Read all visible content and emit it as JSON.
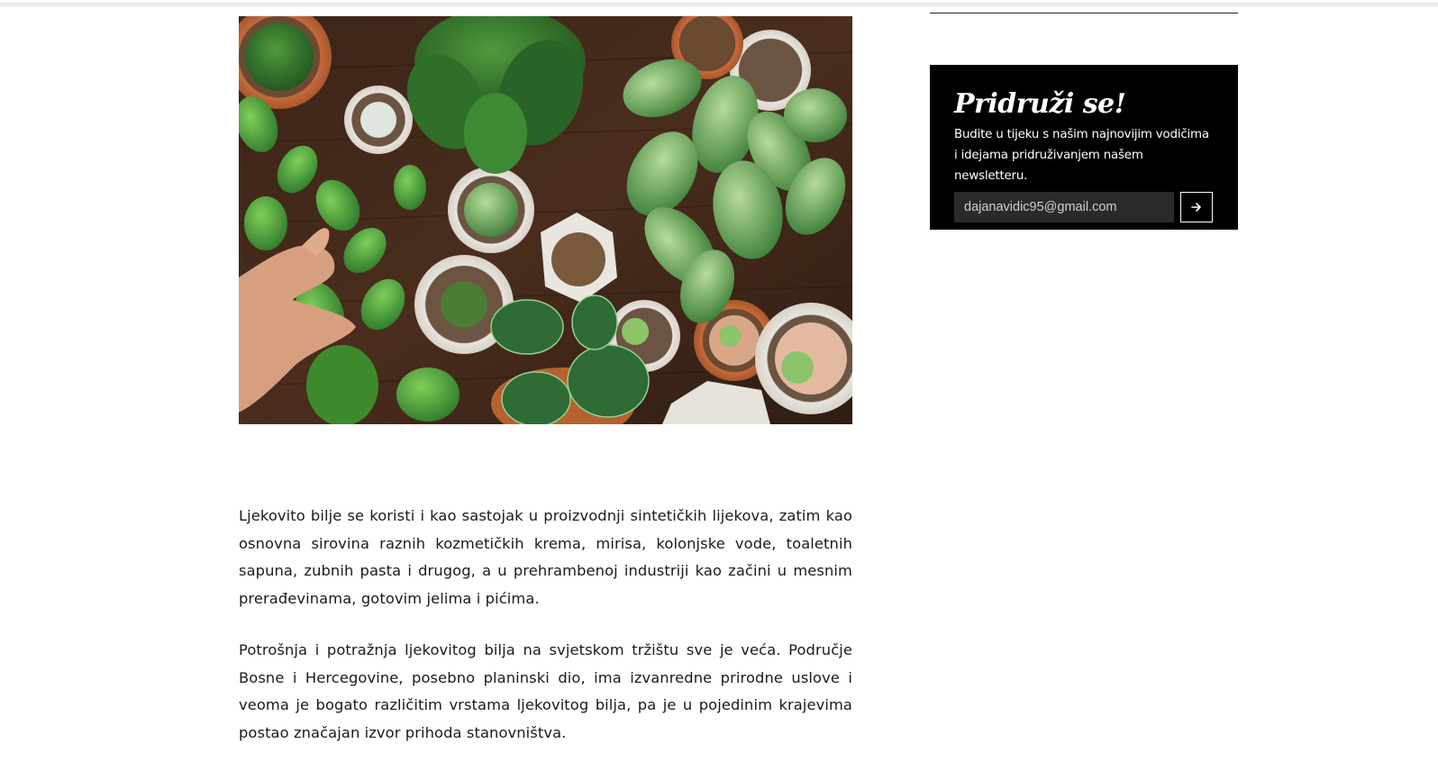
{
  "article": {
    "image_alt": "Ljekovito bilje u saksijama",
    "paragraphs": [
      "Ljekovito bilje se koristi i kao sastojak u proizvodnji sintetičkih lijekova, zatim kao osnovna sirovina raznih kozmetičkih krema, mirisa, kolonjske vode, toaletnih sapuna, zubnih pasta i drugog, a u prehrambenoj industriji kao začini u mesnim prerađevinama, gotovim jelima i pićima.",
      "Potrošnja i potražnja ljekovitog bilja na svjetskom tržištu sve je veća. Područje Bosne i Hercegovine, posebno planinski dio, ima izvanredne prirodne uslove i veoma je bogato različitim vrstama ljekovitog bilja, pa je u pojedinim krajevima postao značajan izvor prihoda stanovništva."
    ]
  },
  "newsletter": {
    "title": "Pridruži se!",
    "text": "Budite u tijeku s našim najnovijim vodičima i idejama pridruživanjem našem newsletteru.",
    "email_value": "dajanavidic95@gmail.com",
    "submit_icon": "arrow-right-icon"
  },
  "colors": {
    "newsletter_bg": "#000000",
    "text": "#1a1a1a"
  }
}
